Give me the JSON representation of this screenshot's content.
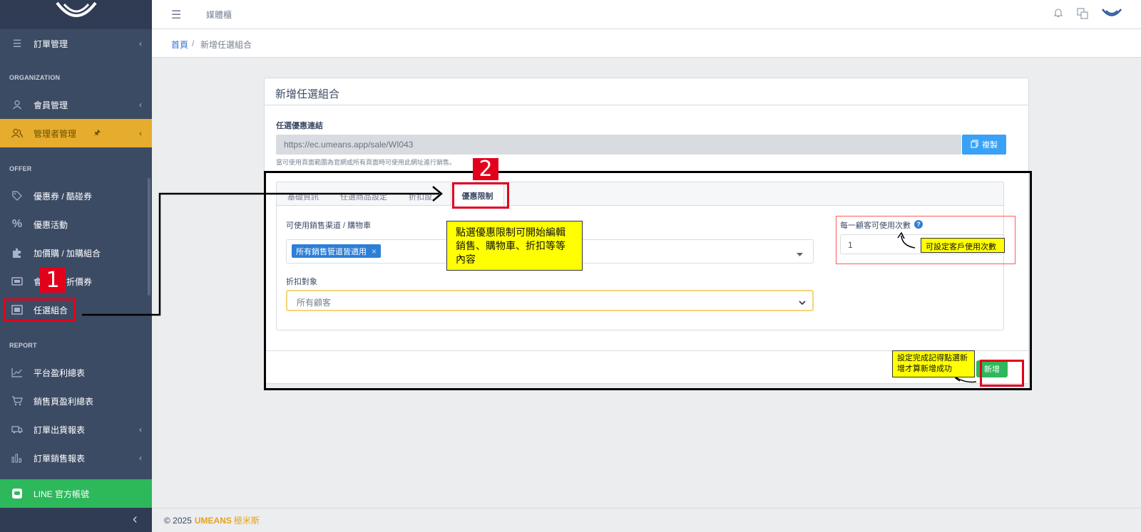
{
  "sidebar": {
    "items": [
      {
        "label": "訂單管理",
        "icon": "list-check-icon",
        "chevron": "‹"
      },
      {
        "label": "會員管理",
        "icon": "user-icon",
        "chevron": "‹"
      },
      {
        "label": "管理者管理",
        "icon": "users-icon",
        "pin": "🖈",
        "chevron": "‹"
      },
      {
        "label": "優惠券 / 酷碰券",
        "icon": "tag-icon"
      },
      {
        "label": "優惠活動",
        "icon": "percent-icon"
      },
      {
        "label": "加價購 / 加購組合",
        "icon": "puzzle-icon"
      },
      {
        "label": "會員券 / 折價券",
        "icon": "ticket-icon"
      },
      {
        "label": "任選組合",
        "icon": "frame-icon"
      },
      {
        "label": "平台盈利總表",
        "icon": "chart-line-icon"
      },
      {
        "label": "銷售頁盈利總表",
        "icon": "cart-icon"
      },
      {
        "label": "訂單出貨報表",
        "icon": "truck-icon",
        "chevron": "‹"
      },
      {
        "label": "訂單銷售報表",
        "icon": "bar-chart-icon",
        "chevron": "‹"
      },
      {
        "label": "LINE 官方帳號",
        "icon": "line-icon"
      }
    ],
    "sections": [
      "ORGANIZATION",
      "OFFER",
      "REPORT"
    ],
    "collapse_label": "‹"
  },
  "topbar": {
    "title": "媒體櫃"
  },
  "breadcrumb": {
    "home": "首頁",
    "sep": "/",
    "current": "新增任選組合"
  },
  "card": {
    "title": "新增任選組合",
    "link_label": "任選優惠連結",
    "link_value": "https://ec.umeans.app/sale/WI043",
    "copy_label": "複製",
    "link_hint": "當可使用頁面範圍為官網或所有頁面時可使用此網址進行銷售。",
    "tabs": [
      "基礎資訊",
      "任選商品設定",
      "折扣設",
      "優惠限制"
    ],
    "channel_label": "可使用銷售渠道 / 購物車",
    "channel_chip": "所有銷售管道皆適用",
    "chip_close": "×",
    "target_label": "折扣對象",
    "target_value": "所有顧客",
    "per_customer_label": "每一顧客可使用次數",
    "per_customer_value": "1",
    "help_icon": "?",
    "submit_label": "新增"
  },
  "annotations": {
    "badge1": "1",
    "badge2": "2",
    "callout_tab": "點選優惠限制可開始編輯銷售、購物車、折扣等等內容",
    "callout_count": "可設定客戶使用次數",
    "callout_submit": "設定完成記得點選新增才算新增成功"
  },
  "footer": {
    "copy": "© 2025",
    "brand": "UMEANS",
    "brand_cn": "極米斯"
  },
  "colors": {
    "sidebar": "#3c4b64",
    "accent": "#e6ac2d",
    "primary": "#39a2f6",
    "success": "#2eb85c",
    "annotation_red": "#e3001b",
    "callout": "#ffff00"
  }
}
